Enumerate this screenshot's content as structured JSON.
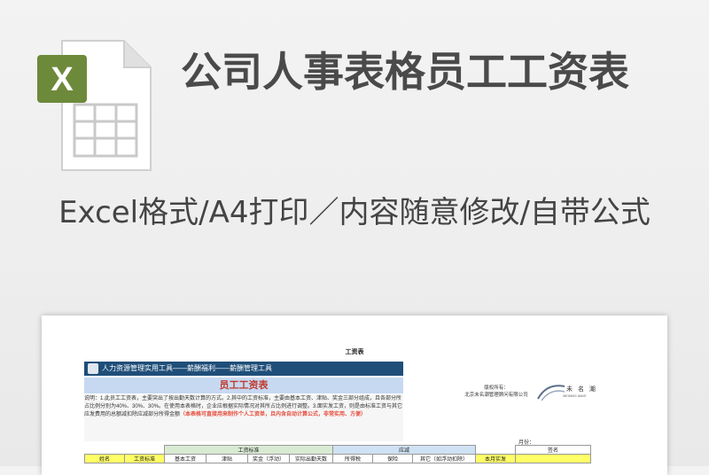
{
  "hero": {
    "title": "公司人事表格员工工资表",
    "subtitle": "Excel格式/A4打印／内容随意修改/自带公式",
    "file_icon": "excel-file-icon",
    "icon_letter": "X",
    "accent": "#6d8a3a"
  },
  "sheet": {
    "title": "工资表",
    "banner": "人力资源管理实用工具——薪酬福利——薪酬管理工具",
    "panel_title": "员工工资表",
    "desc_text": "说明：1.此员工工资表，主要突出了按出勤天数计算的方式。2.其中的工资标准，主要由基本工资、津贴、奖金三部分组成，且各部分所占比例分别为40%、30%、30%。在使用本表格时，企业应根据实际情况对其所占比例进行调整。3.面实发工资，则是由标准工资与其它应发费用的总额减扣除应减部分所得金额",
    "desc_red": "（本表格可直接用来制作个人工资单，且内含自动计算公式，非常实用、方便）",
    "owner_label": "版权所有：",
    "owner_name": "北京未名潮管理顾问有限公司",
    "logo_text": "未 名 潮",
    "logo_sub": "WEIMING WAVE",
    "month_label": "月份：",
    "table": {
      "group_standard": "工资标准",
      "group_deduct": "应减",
      "group_sign": "签名",
      "headers": [
        "姓名",
        "工资标准",
        "基本工资",
        "津贴",
        "奖金（浮动）",
        "实际出勤天数",
        "所得税",
        "保险",
        "其它（如浮动扣除）",
        "本月实发"
      ]
    }
  }
}
